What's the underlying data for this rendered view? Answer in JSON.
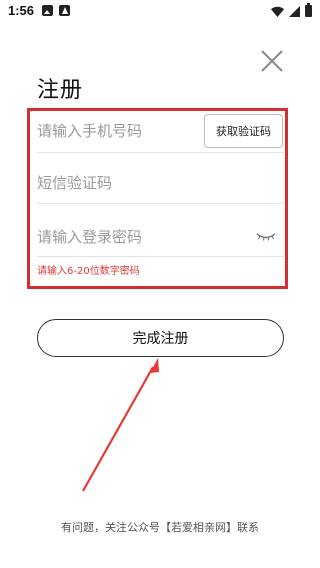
{
  "status_bar": {
    "time": "1:56"
  },
  "page": {
    "title": "注册"
  },
  "form": {
    "phone_placeholder": "请输入手机号码",
    "get_code_label": "获取验证码",
    "sms_placeholder": "短信验证码",
    "password_placeholder": "请输入登录密码",
    "password_hint": "请输入6-20位数字密码",
    "submit_label": "完成注册"
  },
  "footer": {
    "text": "有问题，关注公众号【若爱相亲网】联系"
  },
  "colors": {
    "highlight": "#d32f2f",
    "hint": "#e53935",
    "arrow": "#e53935"
  },
  "icons": {
    "close": "close-icon",
    "eye": "eye-closed-icon",
    "wifi": "wifi-icon",
    "signal": "signal-icon",
    "battery": "battery-icon"
  }
}
